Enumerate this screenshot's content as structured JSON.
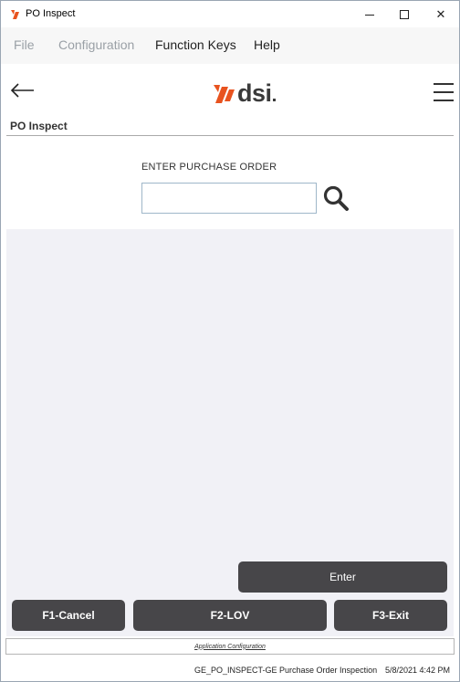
{
  "window": {
    "title": "PO Inspect",
    "close_glyph": "✕"
  },
  "menu": {
    "file": "File",
    "configuration": "Configuration",
    "function_keys": "Function Keys",
    "help": "Help"
  },
  "header": {
    "logo_text": "dsi",
    "back_icon": "left-arrow-icon",
    "menu_icon": "hamburger-icon"
  },
  "page": {
    "title": "PO Inspect"
  },
  "search": {
    "label": "ENTER PURCHASE ORDER",
    "value": "",
    "icon": "search-icon"
  },
  "buttons": {
    "enter": "Enter",
    "f1": "F1-Cancel",
    "f2": "F2-LOV",
    "f3": "F3-Exit"
  },
  "footer": {
    "app_config": "Application Configuration",
    "status_text": "GE_PO_INSPECT-GE Purchase Order Inspection",
    "timestamp": "5/8/2021 4:42 PM"
  },
  "colors": {
    "brand_orange": "#e8531f",
    "button_bg": "#474649",
    "content_bg": "#f1f1f6"
  }
}
